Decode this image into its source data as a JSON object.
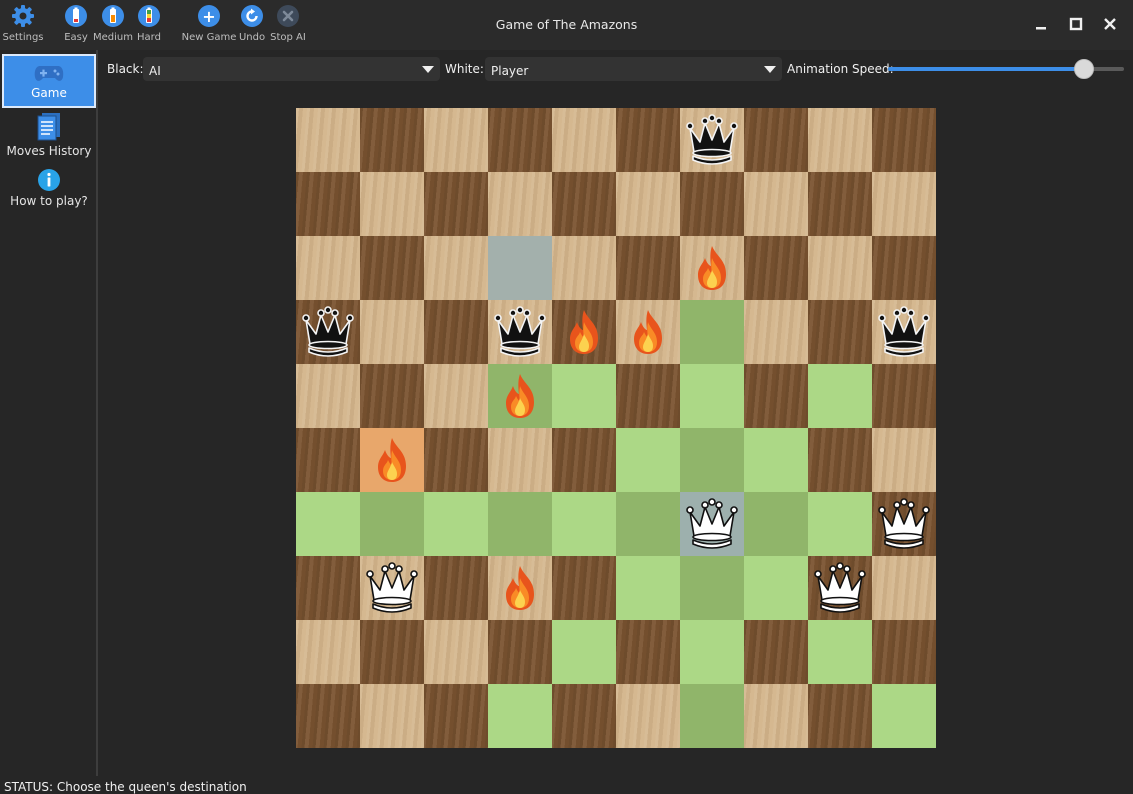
{
  "window": {
    "title": "Game of The Amazons",
    "minimize_label": "—",
    "maximize_label": "☐",
    "close_label": "✕"
  },
  "toolbar": {
    "settings": "Settings",
    "easy": "Easy",
    "medium": "Medium",
    "hard": "Hard",
    "new_game": "New Game",
    "undo": "Undo",
    "stop_ai": "Stop AI"
  },
  "sidebar": {
    "game": "Game",
    "moves_history": "Moves History",
    "how_to_play": "How to play?"
  },
  "settings_bar": {
    "black_label": "Black:",
    "black_value": "AI",
    "white_label": "White:",
    "white_value": "Player",
    "speed_label": "Animation Speed:",
    "speed_level": 0.83
  },
  "board": {
    "size": 10,
    "highlight": [
      [
        3,
        6
      ],
      [
        4,
        3
      ],
      [
        4,
        4
      ],
      [
        4,
        6
      ],
      [
        4,
        8
      ],
      [
        5,
        5
      ],
      [
        5,
        6
      ],
      [
        5,
        7
      ],
      [
        6,
        0
      ],
      [
        6,
        1
      ],
      [
        6,
        2
      ],
      [
        6,
        3
      ],
      [
        6,
        4
      ],
      [
        6,
        5
      ],
      [
        6,
        7
      ],
      [
        6,
        8
      ],
      [
        7,
        5
      ],
      [
        7,
        6
      ],
      [
        7,
        7
      ],
      [
        8,
        4
      ],
      [
        8,
        6
      ],
      [
        8,
        8
      ],
      [
        9,
        3
      ],
      [
        9,
        6
      ],
      [
        9,
        9
      ]
    ],
    "selected": [
      [
        2,
        3
      ],
      [
        6,
        6
      ]
    ],
    "last_move": [
      [
        5,
        1
      ]
    ],
    "pieces": [
      {
        "type": "black-queen",
        "row": 0,
        "col": 6
      },
      {
        "type": "fire",
        "row": 2,
        "col": 6
      },
      {
        "type": "black-queen",
        "row": 3,
        "col": 0
      },
      {
        "type": "black-queen",
        "row": 3,
        "col": 3
      },
      {
        "type": "fire",
        "row": 3,
        "col": 4
      },
      {
        "type": "fire",
        "row": 3,
        "col": 5
      },
      {
        "type": "black-queen",
        "row": 3,
        "col": 9
      },
      {
        "type": "fire",
        "row": 4,
        "col": 3
      },
      {
        "type": "fire",
        "row": 5,
        "col": 1
      },
      {
        "type": "white-queen",
        "row": 6,
        "col": 6
      },
      {
        "type": "white-queen",
        "row": 6,
        "col": 9
      },
      {
        "type": "white-queen",
        "row": 7,
        "col": 1
      },
      {
        "type": "fire",
        "row": 7,
        "col": 3
      },
      {
        "type": "white-queen",
        "row": 7,
        "col": 8
      }
    ]
  },
  "status": "STATUS: Choose the queen's destination"
}
